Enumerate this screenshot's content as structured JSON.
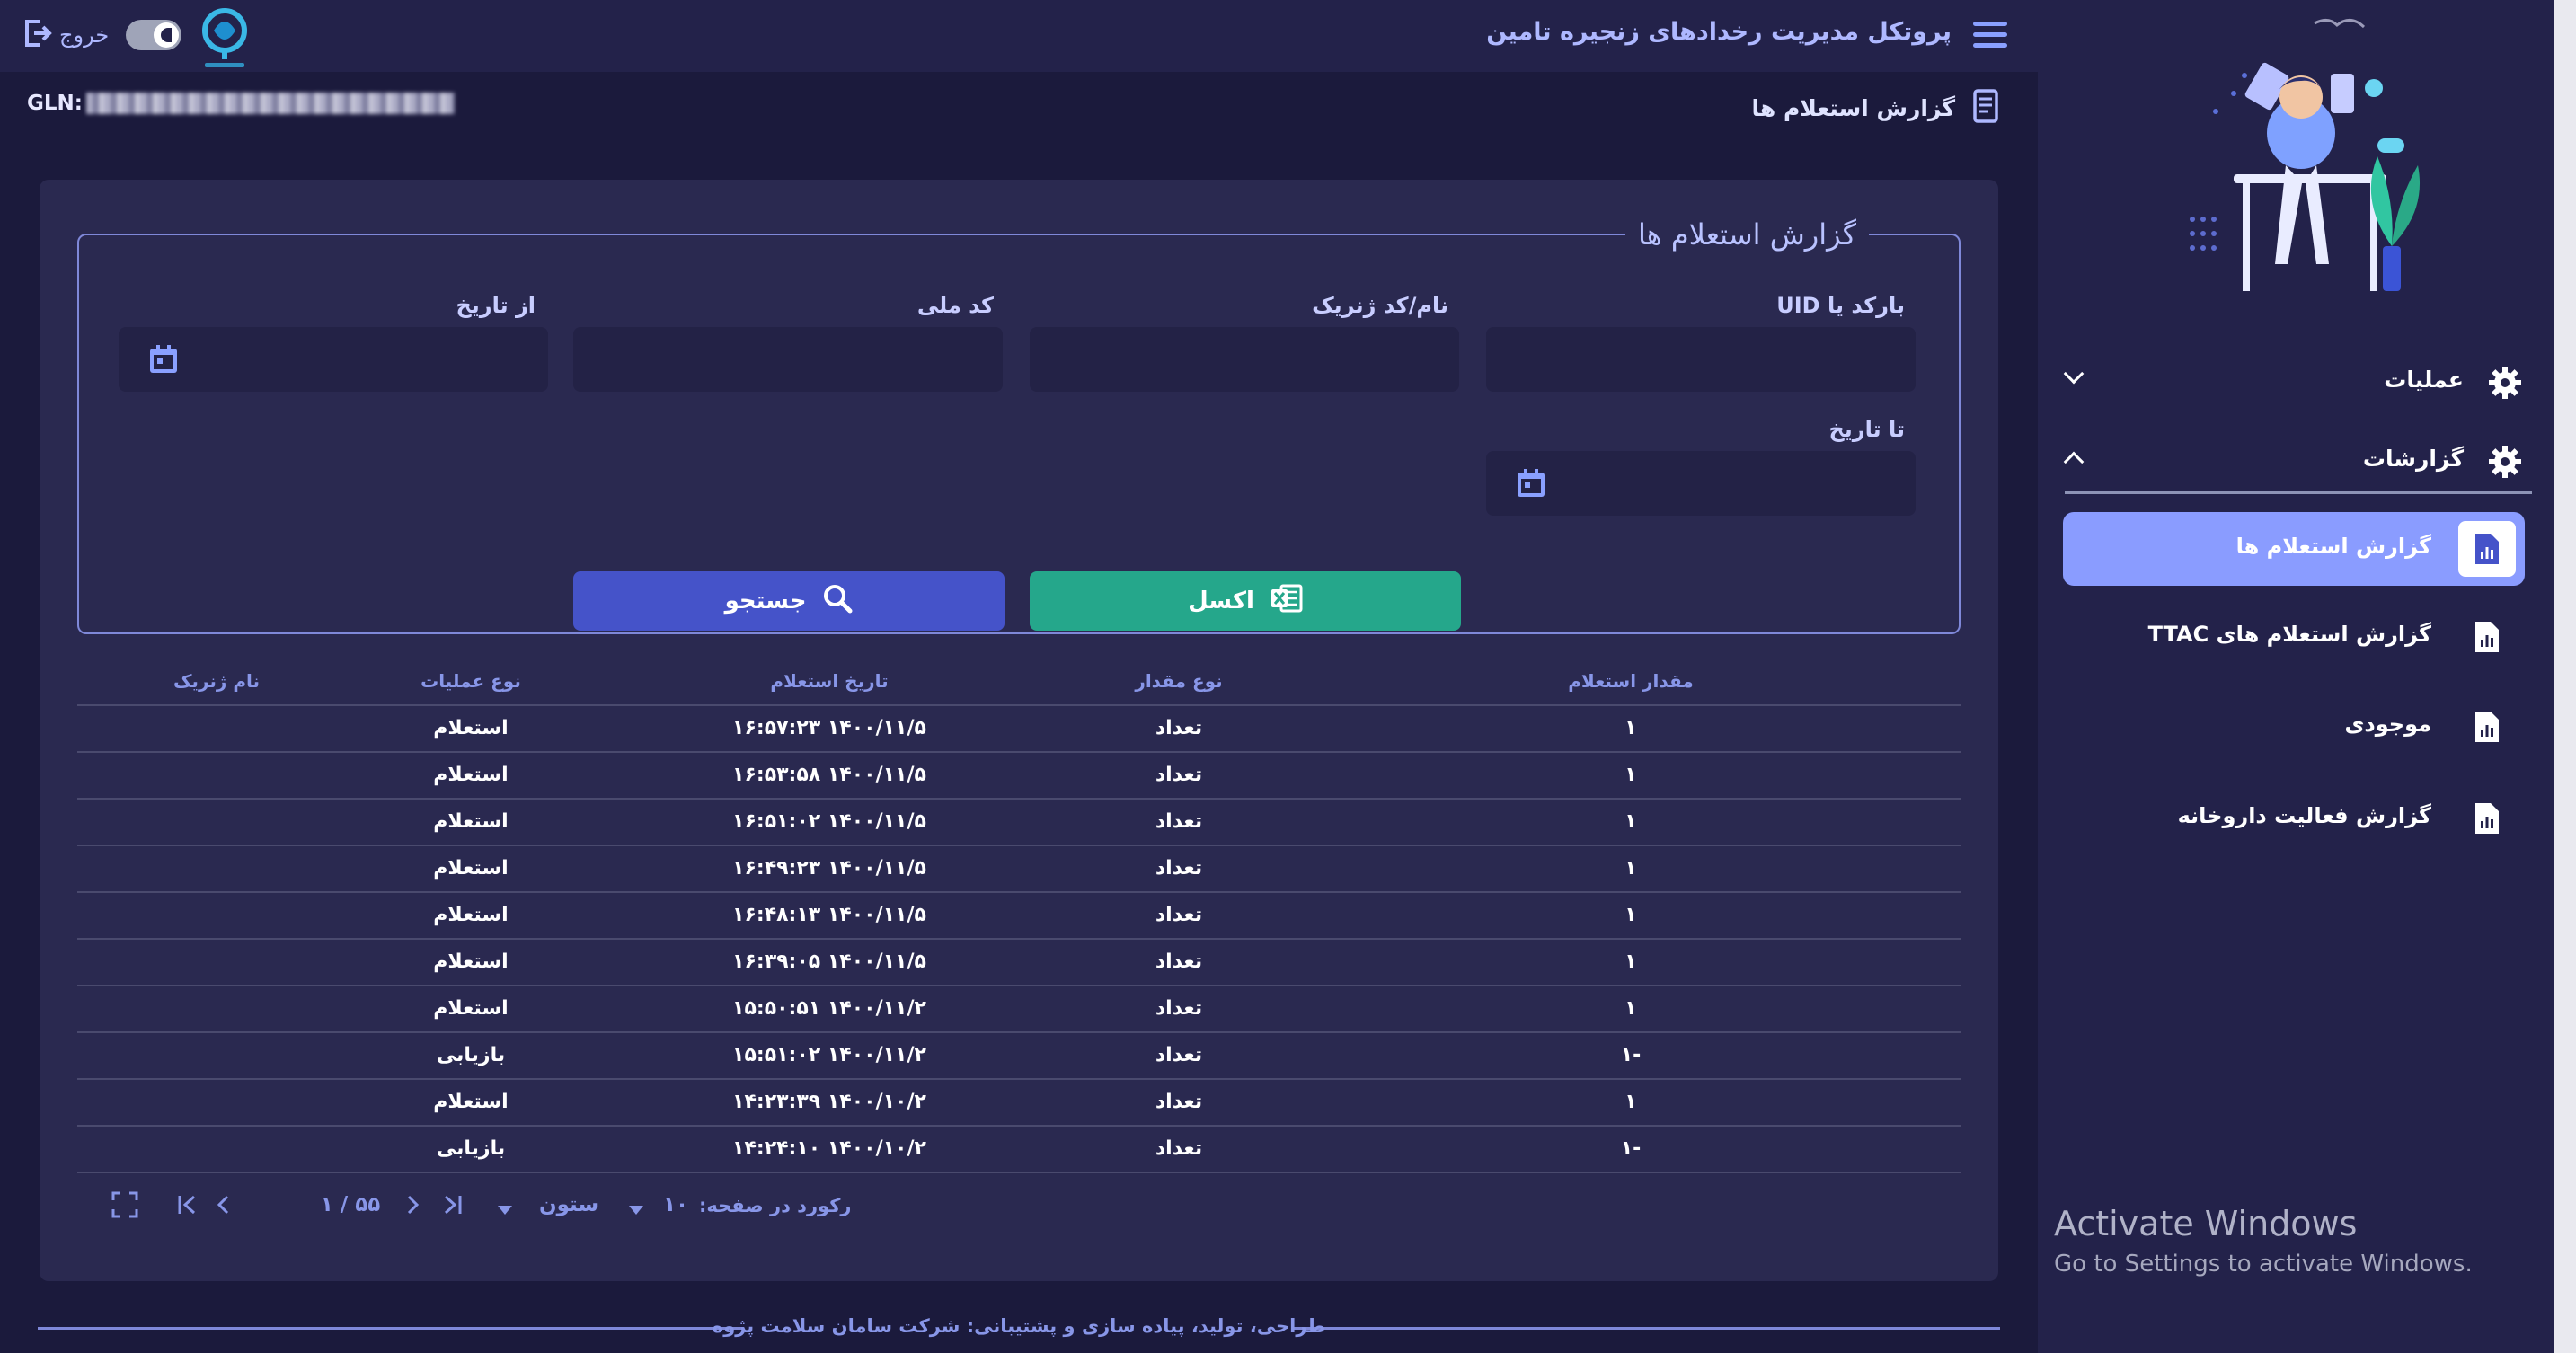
{
  "header": {
    "app_title": "پروتکل مدیریت رخدادهای زنجیره تامین",
    "logout_label": "خروج",
    "gln_label": "GLN:",
    "page_title": "گزارش استعلام ها"
  },
  "filters": {
    "legend": "گزارش استعلام ها",
    "labels": {
      "uid": "بارکد یا UID",
      "generic": "نام/کد ژنریک",
      "national_code": "کد ملی",
      "from_date": "از تاریخ",
      "to_date": "تا تاریخ"
    },
    "buttons": {
      "excel": "اکسل",
      "search": "جستجو"
    }
  },
  "table": {
    "columns": [
      "مقدار استعلام",
      "نوع مقدار",
      "تاریخ استعلام",
      "نوع عملیات",
      "نام ژنریک"
    ],
    "rows": [
      [
        "۱",
        "تعداد",
        "۱۴۰۰/۱۱/۵ ۱۶:۵۷:۲۳",
        "استعلام",
        ""
      ],
      [
        "۱",
        "تعداد",
        "۱۴۰۰/۱۱/۵ ۱۶:۵۳:۵۸",
        "استعلام",
        ""
      ],
      [
        "۱",
        "تعداد",
        "۱۴۰۰/۱۱/۵ ۱۶:۵۱:۰۲",
        "استعلام",
        ""
      ],
      [
        "۱",
        "تعداد",
        "۱۴۰۰/۱۱/۵ ۱۶:۴۹:۲۳",
        "استعلام",
        ""
      ],
      [
        "۱",
        "تعداد",
        "۱۴۰۰/۱۱/۵ ۱۶:۴۸:۱۳",
        "استعلام",
        ""
      ],
      [
        "۱",
        "تعداد",
        "۱۴۰۰/۱۱/۵ ۱۶:۳۹:۰۵",
        "استعلام",
        ""
      ],
      [
        "۱",
        "تعداد",
        "۱۴۰۰/۱۱/۲ ۱۵:۵۰:۵۱",
        "استعلام",
        ""
      ],
      [
        "-۱",
        "تعداد",
        "۱۴۰۰/۱۱/۲ ۱۵:۵۱:۰۲",
        "بازیابی",
        ""
      ],
      [
        "۱",
        "تعداد",
        "۱۴۰۰/۱۰/۲ ۱۴:۲۳:۳۹",
        "استعلام",
        ""
      ],
      [
        "-۱",
        "تعداد",
        "۱۴۰۰/۱۰/۲ ۱۴:۲۴:۱۰",
        "بازیابی",
        ""
      ]
    ]
  },
  "pager": {
    "page_indicator": "۵۵ / ۱",
    "columns_label": "ستون",
    "records_label": "رکورد در صفحه:",
    "records_value": "۱۰"
  },
  "footer": {
    "text": "طراحی، تولید، پیاده سازی و پشتیبانی: شرکت سامان سلامت پژوه"
  },
  "sidebar": {
    "sections": [
      {
        "title": "عملیات",
        "expanded": false
      },
      {
        "title": "گزارشات",
        "expanded": true
      }
    ],
    "items": [
      {
        "label": "گزارش استعلام ها",
        "active": true
      },
      {
        "label": "گزارش استعلام های TTAC",
        "active": false
      },
      {
        "label": "موجودی",
        "active": false
      },
      {
        "label": "گزارش فعالیت داروخانه",
        "active": false
      }
    ]
  },
  "watermark": {
    "title": "Activate Windows",
    "subtitle": "Go to Settings to activate Windows."
  },
  "colors": {
    "background": "#1b1a3c",
    "accent": "#8a9cff",
    "search_button": "#4553c9",
    "excel_button": "#25a78b"
  }
}
